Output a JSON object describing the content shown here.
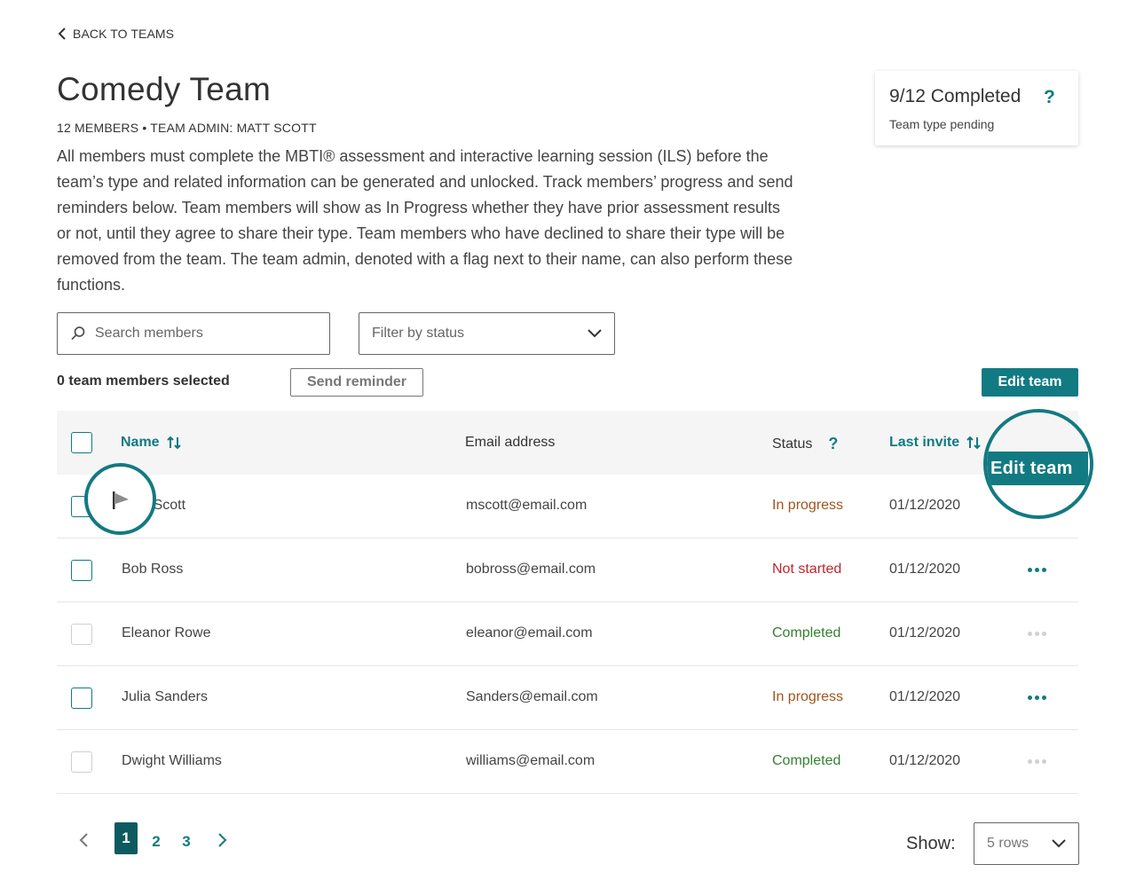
{
  "nav": {
    "back_label": "BACK TO TEAMS"
  },
  "team": {
    "title": "Comedy Team",
    "subtitle": "12 MEMBERS • TEAM ADMIN: MATT SCOTT",
    "description": "All members must complete the MBTI® assessment and interactive learning session (ILS) before the team’s type and related information can be generated and unlocked. Track members’ progress and send reminders below. Team members will show as In Progress whether they have prior assessment results or not, until they agree to share their type. Team members who have declined to share their type will be removed from the team. The team admin, denoted with a flag next to their name, can also perform these functions."
  },
  "progress_card": {
    "count": "9/12 Completed",
    "help": "?",
    "status": "Team type pending"
  },
  "filters": {
    "search_placeholder": "Search members",
    "status_placeholder": "Filter by status"
  },
  "actions": {
    "selected_count": "0 team members selected",
    "send_reminder": "Send reminder",
    "edit_team": "Edit team"
  },
  "table": {
    "headers": {
      "name": "Name",
      "email": "Email address",
      "status": "Status",
      "status_help": "?",
      "last_invite": "Last invite"
    },
    "rows": [
      {
        "name": "Matt Scott",
        "email": "mscott@email.com",
        "status": "In progress",
        "last_invite": "01/12/2020",
        "checkbox": "active",
        "admin": true
      },
      {
        "name": "Bob Ross",
        "email": "bobross@email.com",
        "status": "Not started",
        "last_invite": "01/12/2020",
        "checkbox": "active",
        "menu": "enabled"
      },
      {
        "name": "Eleanor Rowe",
        "email": "eleanor@email.com",
        "status": "Completed",
        "last_invite": "01/12/2020",
        "checkbox": "disabled",
        "menu": "disabled"
      },
      {
        "name": "Julia Sanders",
        "email": "Sanders@email.com",
        "status": "In progress",
        "last_invite": "01/12/2020",
        "checkbox": "active",
        "menu": "enabled"
      },
      {
        "name": "Dwight Williams",
        "email": "williams@email.com",
        "status": "Completed",
        "last_invite": "01/12/2020",
        "checkbox": "disabled",
        "menu": "disabled"
      }
    ]
  },
  "callout": {
    "edit_team_zoom": "Edit team"
  },
  "pagination": {
    "pages": [
      "1",
      "2",
      "3"
    ],
    "current": "1"
  },
  "rows_per_page": {
    "label": "Show:",
    "value": "5 rows"
  },
  "colors": {
    "accent": "#127a82",
    "in_progress": "#a0551d",
    "not_started": "#c0262d",
    "completed": "#35802f"
  }
}
